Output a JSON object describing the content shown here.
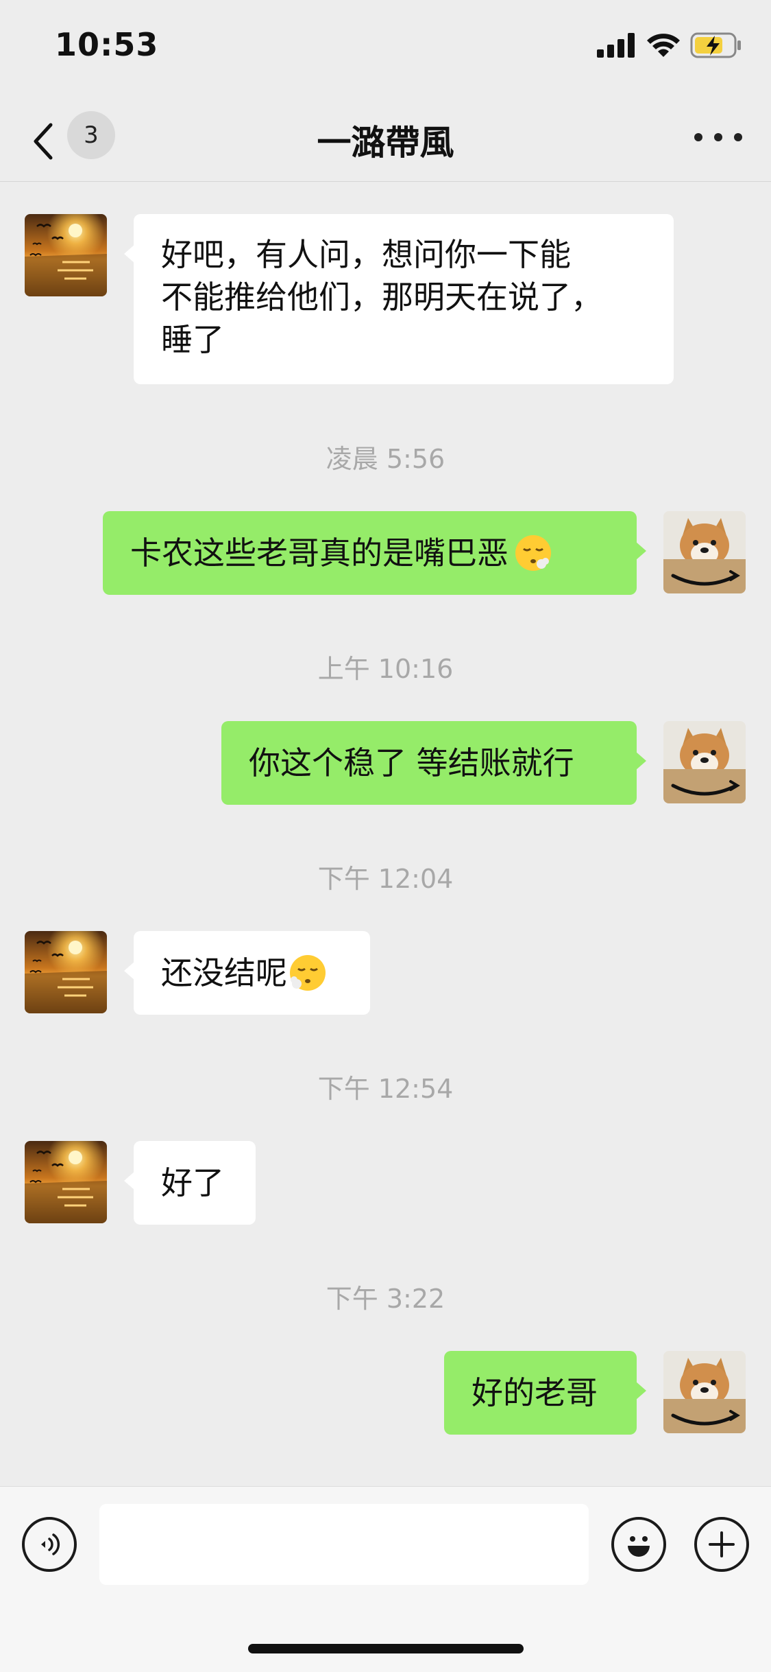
{
  "status_bar": {
    "time": "10:53"
  },
  "nav": {
    "unread_count": "3",
    "title": "一潞帶風"
  },
  "messages": [
    {
      "side": "in",
      "text": "好吧，有人问，想问你一下能\n不能推给他们，那明天在说了，\n睡了"
    },
    {
      "timestamp": "凌晨 5:56"
    },
    {
      "side": "out",
      "text": "卡农这些老哥真的是嘴巴恶",
      "emoji": "face-exhaling-icon"
    },
    {
      "timestamp": "上午 10:16"
    },
    {
      "side": "out",
      "text": "你这个稳了 等结账就行"
    },
    {
      "timestamp": "下午 12:04"
    },
    {
      "side": "in",
      "text": "还没结呢",
      "emoji": "face-exhaling-icon"
    },
    {
      "timestamp": "下午 12:54"
    },
    {
      "side": "in",
      "text": "好了"
    },
    {
      "timestamp": "下午 3:22"
    },
    {
      "side": "out",
      "text": "好的老哥"
    }
  ],
  "input": {
    "placeholder": ""
  },
  "colors": {
    "incoming_bubble": "#ffffff",
    "outgoing_bubble": "#95ec69",
    "background": "#ededed",
    "timestamp": "#a8a8a8"
  }
}
